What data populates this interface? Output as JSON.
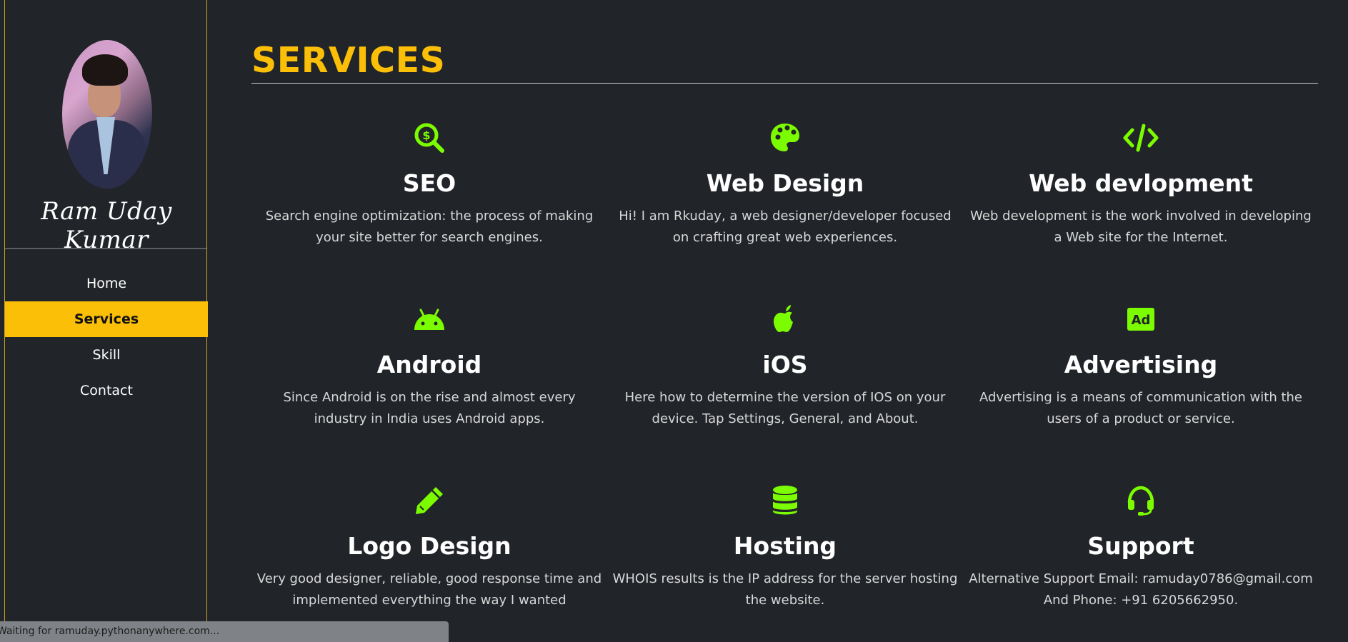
{
  "sidebar": {
    "profile_name": "Ram Uday Kumar",
    "nav": [
      {
        "label": "Home",
        "active": false
      },
      {
        "label": "Services",
        "active": true
      },
      {
        "label": "Skill",
        "active": false
      },
      {
        "label": "Contact",
        "active": false
      }
    ]
  },
  "main": {
    "title": "SERVICES",
    "services": [
      {
        "icon": "search-dollar-icon",
        "title": "SEO",
        "description": "Search engine optimization: the process of making your site better for search engines."
      },
      {
        "icon": "palette-icon",
        "title": "Web Design",
        "description": "Hi! I am Rkuday, a web designer/developer focused on crafting great web experiences."
      },
      {
        "icon": "code-icon",
        "title": "Web devlopment",
        "description": "Web development is the work involved in developing a Web site for the Internet."
      },
      {
        "icon": "android-icon",
        "title": "Android",
        "description": "Since Android is on the rise and almost every industry in India uses Android apps."
      },
      {
        "icon": "apple-icon",
        "title": "iOS",
        "description": "Here how to determine the version of IOS on your device. Tap Settings, General, and About."
      },
      {
        "icon": "ad-icon",
        "title": "Advertising",
        "description": "Advertising is a means of communication with the users of a product or service."
      },
      {
        "icon": "pencil-icon",
        "title": "Logo Design",
        "description": "Very good designer, reliable, good response time and implemented everything the way I wanted"
      },
      {
        "icon": "database-icon",
        "title": "Hosting",
        "description": "WHOIS results is the IP address for the server hosting the website."
      },
      {
        "icon": "headset-icon",
        "title": "Support",
        "description": "Alternative Support Email: ramuday0786@gmail.com And Phone: +91 6205662950."
      }
    ]
  },
  "status_bar": {
    "text": "Waiting for ramuday.pythonanywhere.com..."
  },
  "colors": {
    "background": "#212429",
    "accent": "#fcbf07",
    "icon": "#7cfc00"
  }
}
